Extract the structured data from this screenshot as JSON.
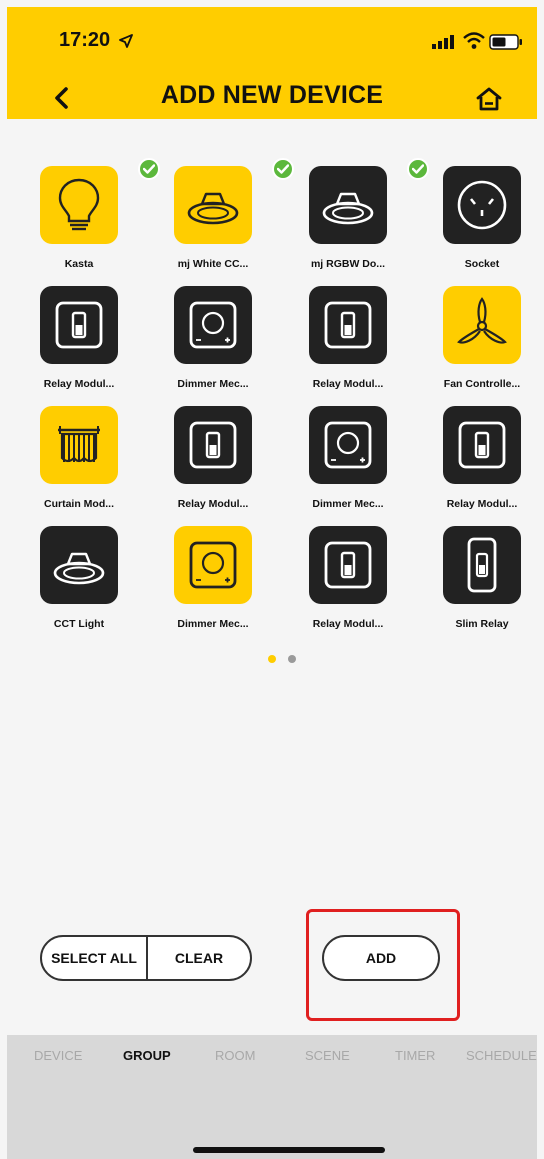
{
  "status": {
    "time": "17:20"
  },
  "header": {
    "title": "ADD NEW DEVICE"
  },
  "devices": [
    {
      "label": "Kasta",
      "icon": "bulb-icon",
      "color": "yellow",
      "checked": true
    },
    {
      "label": "mj White CC...",
      "icon": "downlight-icon",
      "color": "yellow",
      "checked": true
    },
    {
      "label": "mj RGBW Do...",
      "icon": "downlight-icon",
      "color": "dark",
      "checked": true
    },
    {
      "label": "Socket",
      "icon": "socket-icon",
      "color": "dark",
      "checked": false
    },
    {
      "label": "Relay Modul...",
      "icon": "relay-switch-icon",
      "color": "dark",
      "checked": false
    },
    {
      "label": "Dimmer Mec...",
      "icon": "dimmer-icon",
      "color": "dark",
      "checked": false
    },
    {
      "label": "Relay Modul...",
      "icon": "relay-switch-icon",
      "color": "dark",
      "checked": false
    },
    {
      "label": "Fan Controlle...",
      "icon": "fan-icon",
      "color": "yellow",
      "checked": false
    },
    {
      "label": "Curtain Mod...",
      "icon": "curtain-icon",
      "color": "yellow",
      "checked": false
    },
    {
      "label": "Relay Modul...",
      "icon": "relay-switch-icon",
      "color": "dark",
      "checked": false
    },
    {
      "label": "Dimmer Mec...",
      "icon": "dimmer-icon",
      "color": "dark",
      "checked": false
    },
    {
      "label": "Relay Modul...",
      "icon": "relay-switch-icon",
      "color": "dark",
      "checked": false
    },
    {
      "label": "CCT Light",
      "icon": "downlight-icon",
      "color": "dark",
      "checked": false
    },
    {
      "label": "Dimmer Mec...",
      "icon": "dimmer-icon",
      "color": "yellow",
      "checked": false
    },
    {
      "label": "Relay Modul...",
      "icon": "relay-switch-icon",
      "color": "dark",
      "checked": false
    },
    {
      "label": "Slim Relay",
      "icon": "slim-relay-icon",
      "color": "dark",
      "checked": false
    }
  ],
  "pager": {
    "pages": 2,
    "current": 1
  },
  "actions": {
    "select_all": "SELECT ALL",
    "clear": "CLEAR",
    "add": "ADD"
  },
  "tabs": [
    {
      "label": "DEVICE",
      "active": false
    },
    {
      "label": "GROUP",
      "active": true
    },
    {
      "label": "ROOM",
      "active": false
    },
    {
      "label": "SCENE",
      "active": false
    },
    {
      "label": "TIMER",
      "active": false
    },
    {
      "label": "SCHEDULE",
      "active": false
    }
  ],
  "colors": {
    "accent": "#FFCD00",
    "tile_dark": "#222222",
    "check": "#5cb83c",
    "highlight": "#e02020"
  }
}
